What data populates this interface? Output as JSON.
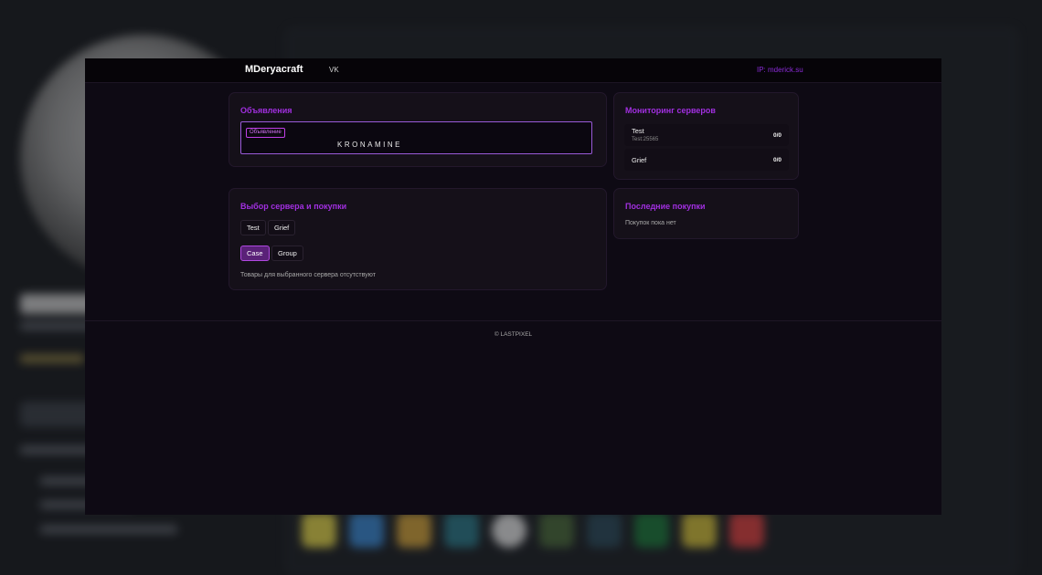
{
  "navbar": {
    "brand": "MDeryacraft",
    "vk_link": "VK",
    "ip": "IP: mderick.su"
  },
  "announcements": {
    "title": "Объявления",
    "badge": "Объявление",
    "text": "KRONAMINE"
  },
  "monitoring": {
    "title": "Мониторинг серверов",
    "servers": [
      {
        "name": "Test",
        "address": "Test:25565",
        "online": "0/0"
      },
      {
        "name": "Grief",
        "address": "",
        "online": "0/0"
      }
    ]
  },
  "shop": {
    "title": "Выбор сервера и покупки",
    "servers": [
      "Test",
      "Grief"
    ],
    "categories": [
      "Case",
      "Group"
    ],
    "active_category": "Case",
    "empty_text": "Товары для выбранного сервера отсутствуют"
  },
  "recent": {
    "title": "Последние покупки",
    "empty_text": "Покупок пока нет"
  },
  "footer": {
    "copyright": "© LASTPIXEL"
  },
  "colors": {
    "accent": "#a12fe0",
    "active_button": "#5a2178",
    "window_bg": "#0e0a14",
    "card_bg": "#151019"
  }
}
